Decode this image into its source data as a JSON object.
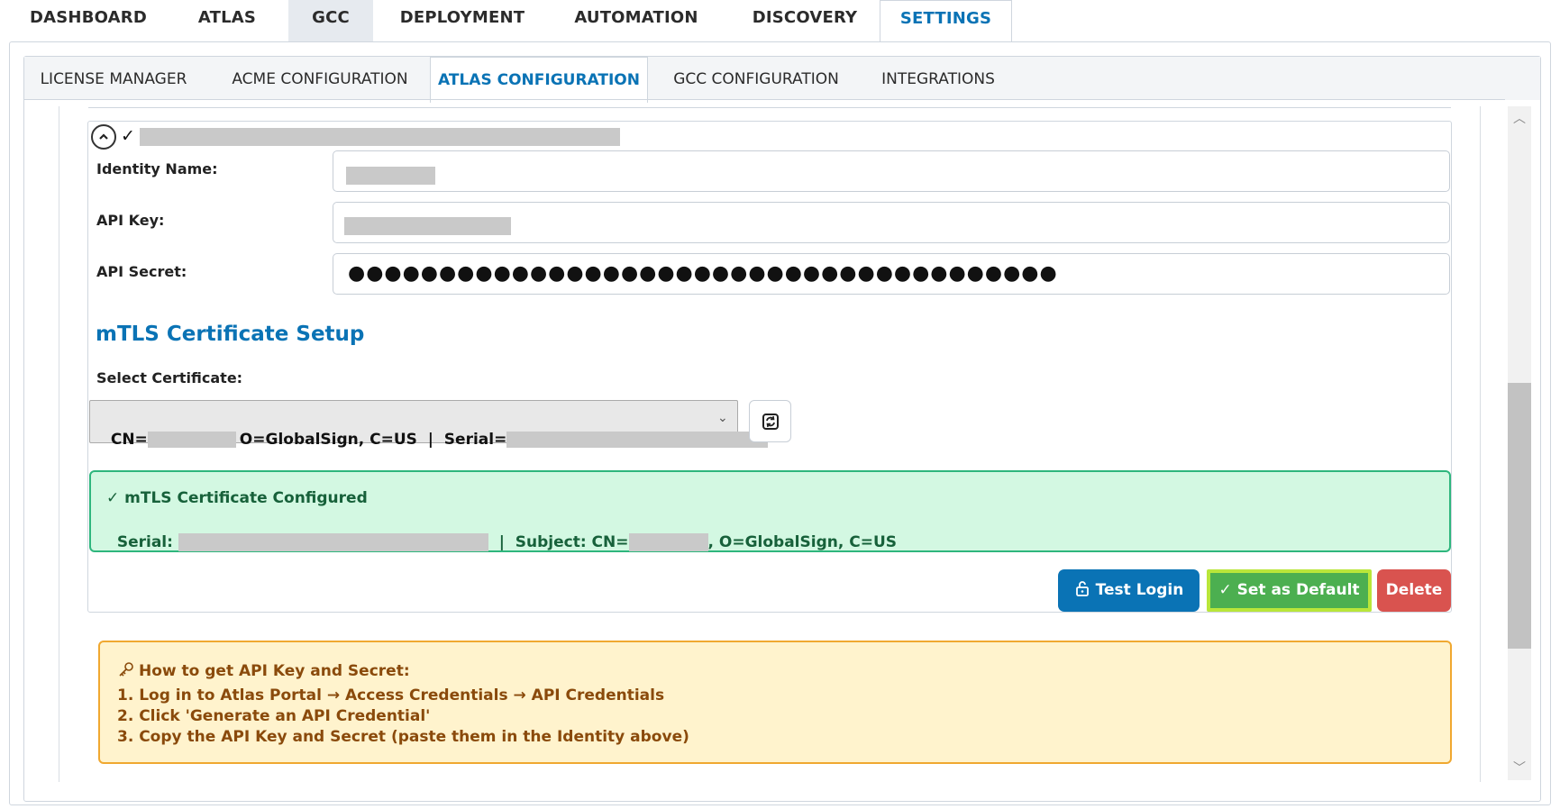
{
  "top_nav": {
    "tabs": [
      {
        "label": "DASHBOARD"
      },
      {
        "label": "ATLAS"
      },
      {
        "label": "GCC"
      },
      {
        "label": "DEPLOYMENT"
      },
      {
        "label": "AUTOMATION"
      },
      {
        "label": "DISCOVERY"
      },
      {
        "label": "SETTINGS"
      }
    ],
    "active": "SETTINGS"
  },
  "sub_nav": {
    "tabs": [
      {
        "label": "LICENSE MANAGER"
      },
      {
        "label": "ACME CONFIGURATION"
      },
      {
        "label": "ATLAS CONFIGURATION"
      },
      {
        "label": "GCC CONFIGURATION"
      },
      {
        "label": "INTEGRATIONS"
      }
    ],
    "active": "ATLAS CONFIGURATION"
  },
  "identity": {
    "collapse_icon": "chevron-up-icon",
    "header_check": "✓",
    "fields": {
      "identity_name_label": "Identity Name:",
      "api_key_label": "API Key:",
      "api_secret_label": "API Secret:",
      "api_secret_value": "●●●●●●●●●●●●●●●●●●●●●●●●●●●●●●●●●●●●●●●"
    },
    "mtls": {
      "title": "mTLS Certificate Setup",
      "select_label": "Select Certificate:",
      "select_value_prefix": "CN=",
      "select_value_org": "O=GlobalSign, C=US  |  Serial=",
      "refresh_icon": "refresh-icon",
      "success_title": "✓ mTLS Certificate Configured",
      "success_serial_label": "Serial:",
      "success_subject_label": "|  Subject: CN=",
      "success_subject_rest": ", O=GlobalSign, C=US"
    },
    "buttons": {
      "test_login": "Test Login",
      "set_default": "✓ Set as Default",
      "delete": "Delete"
    }
  },
  "help": {
    "icon": "key-icon",
    "title": "How to get API Key and Secret:",
    "steps": [
      "1. Log in to Atlas Portal → Access Credentials → API Credentials",
      "2. Click 'Generate an API Credential'",
      "3. Copy the API Key and Secret (paste them in the Identity above)"
    ]
  },
  "colors": {
    "accent": "#0a73b5",
    "success_bg": "#d3f8e2",
    "success_border": "#2eb67d",
    "warning_bg": "#fff3cd",
    "warning_border": "#f0a830",
    "delete": "#d9534f",
    "default_btn": "#4caf50"
  }
}
